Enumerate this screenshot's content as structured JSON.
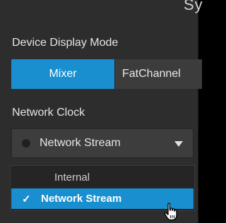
{
  "header": {
    "cut_title": "Sy"
  },
  "display_mode": {
    "label": "Device Display Mode",
    "options": [
      "Mixer",
      "FatChannel"
    ],
    "selected": "Mixer"
  },
  "network_clock": {
    "label": "Network Clock",
    "selected_value": "Network Stream",
    "menu": {
      "items": [
        {
          "label": "Internal",
          "checked": false
        },
        {
          "label": "Network Stream",
          "checked": true
        }
      ],
      "check_glyph": "✓"
    }
  },
  "colors": {
    "accent": "#1a8fd0",
    "panel_bg": "#2d2d2d",
    "control_bg": "#3d3d3d"
  },
  "icons": {
    "status_indicator": "status-dot-icon",
    "dropdown": "caret-down-icon",
    "cursor": "hand-pointer-icon"
  }
}
